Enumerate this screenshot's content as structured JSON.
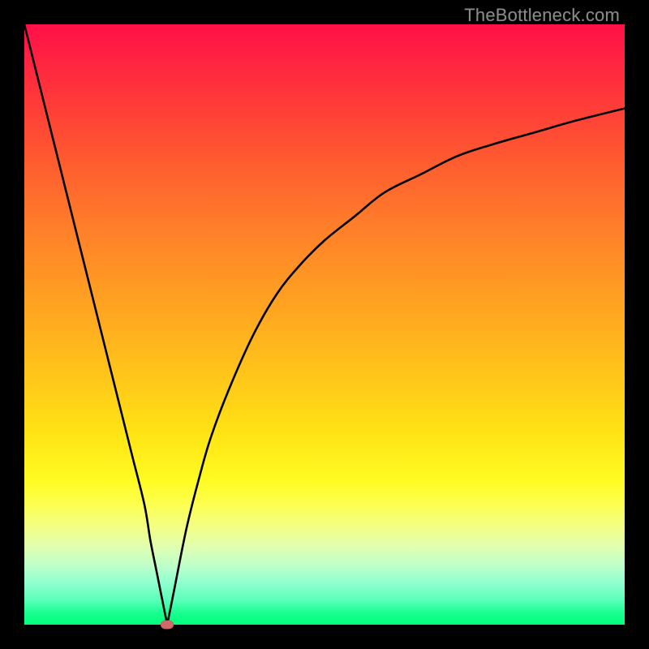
{
  "watermark": "TheBottleneck.com",
  "chart_data": {
    "type": "line",
    "title": "",
    "xlabel": "",
    "ylabel": "",
    "xlim": [
      0,
      100
    ],
    "ylim": [
      0,
      100
    ],
    "grid": false,
    "legend": false,
    "series": [
      {
        "name": "bottleneck-curve-left",
        "x": [
          0,
          2,
          4,
          6,
          8,
          10,
          12,
          14,
          16,
          18,
          20,
          21,
          22,
          23,
          23.8
        ],
        "values": [
          100,
          92,
          84,
          76,
          68,
          60,
          52,
          44,
          36,
          28,
          20,
          14,
          9,
          4,
          0
        ]
      },
      {
        "name": "bottleneck-curve-right",
        "x": [
          23.8,
          25,
          27,
          29,
          31,
          34,
          38,
          42,
          46,
          50,
          55,
          60,
          66,
          72,
          78,
          85,
          92,
          100
        ],
        "values": [
          0,
          6,
          16,
          24,
          31,
          39,
          48,
          55,
          60,
          64,
          68,
          72,
          75,
          78,
          80,
          82,
          84,
          86
        ]
      }
    ],
    "marker": {
      "x": 23.8,
      "y": 0,
      "name": "optimal-point"
    },
    "background_gradient": {
      "orientation": "vertical",
      "stops": [
        {
          "pos": 0.0,
          "color": "#ff1048"
        },
        {
          "pos": 0.5,
          "color": "#ffc41a"
        },
        {
          "pos": 0.78,
          "color": "#fffb22"
        },
        {
          "pos": 1.0,
          "color": "#00ff78"
        }
      ]
    }
  }
}
